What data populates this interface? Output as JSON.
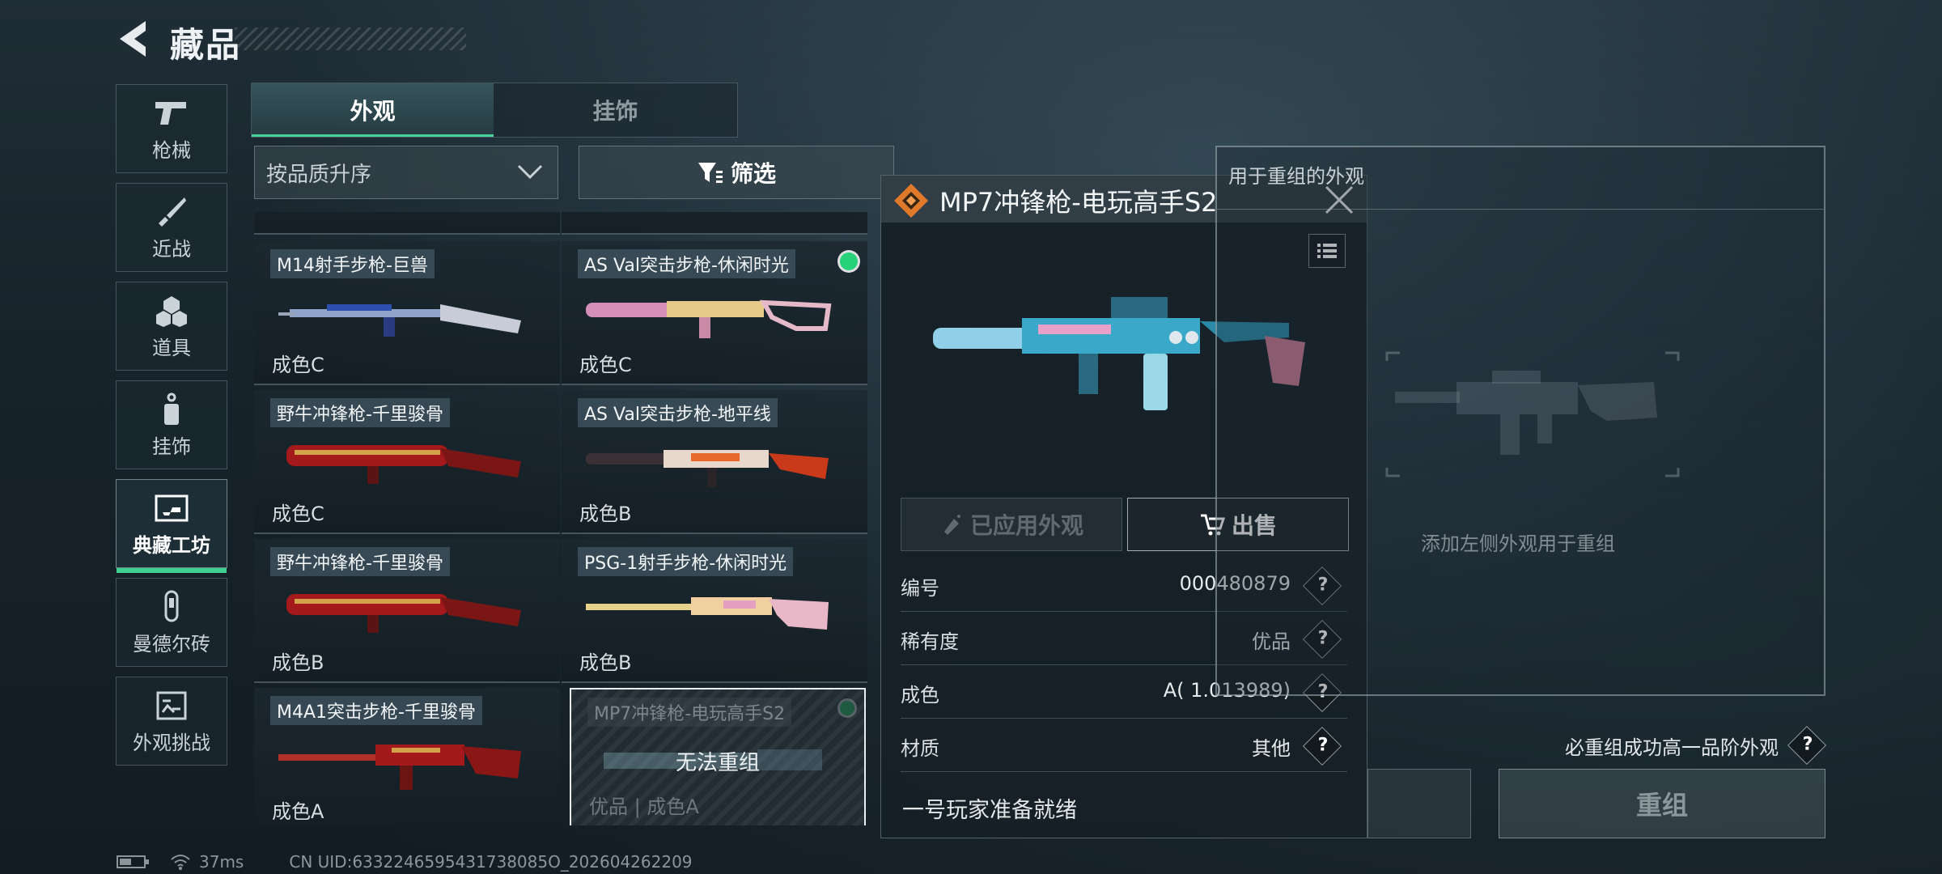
{
  "header": {
    "title": "藏品"
  },
  "sidebar": {
    "items": [
      {
        "label": "枪械",
        "icon": "pistol-icon"
      },
      {
        "label": "近战",
        "icon": "knife-icon"
      },
      {
        "label": "道具",
        "icon": "grenade-icon"
      },
      {
        "label": "挂饰",
        "icon": "charm-icon"
      },
      {
        "label": "典藏工坊",
        "icon": "workshop-icon",
        "active": true
      },
      {
        "label": "曼德尔砖",
        "icon": "brick-icon"
      },
      {
        "label": "外观挑战",
        "icon": "challenge-icon"
      }
    ]
  },
  "tabs": [
    {
      "label": "外观",
      "active": true
    },
    {
      "label": "挂饰"
    }
  ],
  "sort": {
    "value": "按品质升序"
  },
  "filter": {
    "label": "筛选"
  },
  "grid": {
    "items": [
      {
        "name": "M14射手步枪-巨兽",
        "grade": "成色C"
      },
      {
        "name": "AS Val突击步枪-休闲时光",
        "grade": "成色C",
        "equipped": true
      },
      {
        "name": "野牛冲锋枪-千里骏骨",
        "grade": "成色C"
      },
      {
        "name": "AS Val突击步枪-地平线",
        "grade": "成色B"
      },
      {
        "name": "野牛冲锋枪-千里骏骨",
        "grade": "成色B"
      },
      {
        "name": "PSG-1射手步枪-休闲时光",
        "grade": "成色B"
      },
      {
        "name": "M4A1突击步枪-千里骏骨",
        "grade": "成色A"
      },
      {
        "name": "MP7冲锋枪-电玩高手S2",
        "grade": "优品 | 成色A",
        "selected": true,
        "message": "无法重组"
      }
    ]
  },
  "detail": {
    "title": "MP7冲锋枪-电玩高手S2",
    "applied_label": "已应用外观",
    "sell_label": "出售",
    "rows": [
      {
        "key": "编号",
        "value": "000480879"
      },
      {
        "key": "稀有度",
        "value": "优品"
      },
      {
        "key": "成色",
        "value": "A( 1.013989)"
      },
      {
        "key": "材质",
        "value": "其他"
      }
    ],
    "description": "一号玩家准备就绪"
  },
  "recombine": {
    "title": "用于重组的外观",
    "hint": "添加左侧外观用于重组",
    "guarantee": "必重组成功高一品阶外观",
    "button": "重组"
  },
  "status": {
    "ping": "37ms",
    "uid": "CN UID:6332246595431738085O_202604262209"
  },
  "colors": {
    "accent_green": "#3fcf8e",
    "equipped_dot": "#26d17a",
    "rarity_orange": "#e07a2a"
  }
}
